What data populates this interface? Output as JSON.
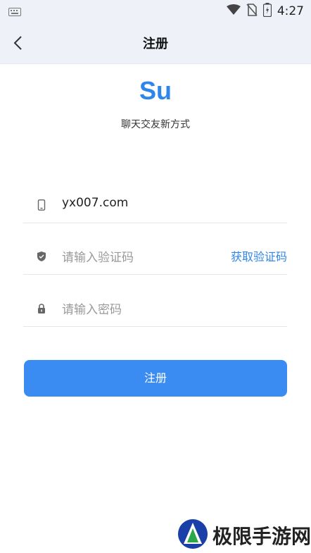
{
  "status_bar": {
    "time": "4:27",
    "icons": [
      "keyboard-icon",
      "wifi-icon",
      "no-sim-icon",
      "battery-icon"
    ]
  },
  "header": {
    "title": "注册",
    "back_icon": "chevron-left-icon"
  },
  "brand": {
    "logo_text": "Su",
    "tagline": "聊天交友新方式",
    "color": "#2f86ea"
  },
  "form": {
    "phone": {
      "value": "yx007.com",
      "icon": "phone-icon"
    },
    "code": {
      "placeholder": "请输入验证码",
      "action_label": "获取验证码",
      "icon": "shield-icon"
    },
    "password": {
      "placeholder": "请输入密码",
      "icon": "lock-icon"
    },
    "submit_label": "注册",
    "submit_color": "#3a8cf2"
  },
  "watermark": {
    "text": "极限手游网"
  }
}
